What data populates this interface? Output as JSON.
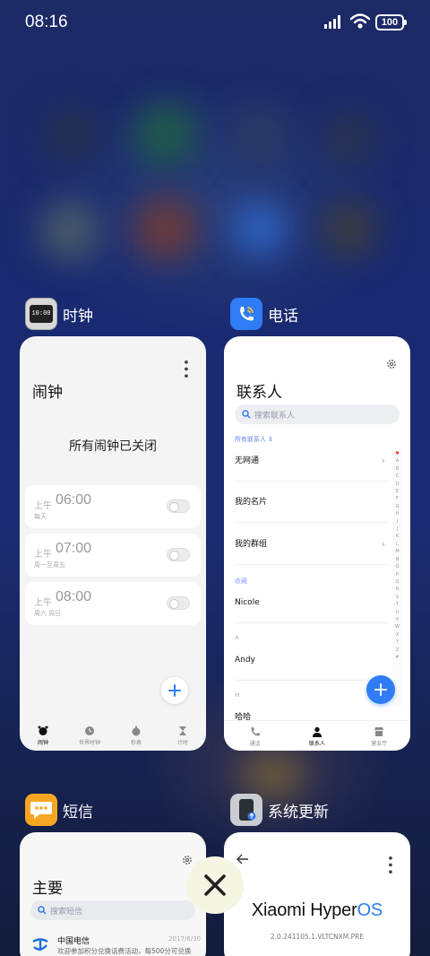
{
  "status_bar": {
    "time": "08:16",
    "battery": "100"
  },
  "apps": [
    {
      "name": "时钟",
      "icon": "clock-app-icon",
      "icon_text": "10:00",
      "card": {
        "title": "闹钟",
        "empty_text": "所有闹钟已关闭",
        "alarms": [
          {
            "ampm": "上午",
            "time": "06:00",
            "repeat": "每天",
            "enabled": false
          },
          {
            "ampm": "上午",
            "time": "07:00",
            "repeat": "周一至周五",
            "enabled": false
          },
          {
            "ampm": "上午",
            "time": "08:00",
            "repeat": "周六 周日",
            "enabled": false
          }
        ],
        "tabs": [
          {
            "label": "闹钟",
            "icon": "alarm-icon",
            "active": true
          },
          {
            "label": "世界时钟",
            "icon": "world-clock-icon",
            "active": false
          },
          {
            "label": "秒表",
            "icon": "stopwatch-icon",
            "active": false
          },
          {
            "label": "计时",
            "icon": "timer-icon",
            "active": false
          }
        ]
      }
    },
    {
      "name": "电话",
      "icon": "phone-app-icon",
      "card": {
        "title": "联系人",
        "search_placeholder": "搜索联系人",
        "filter": "所有联系人 ⇕",
        "rows": [
          "无网通",
          "我的名片",
          "我的群组"
        ],
        "favorites_header": "收藏",
        "favorite": "Nicole",
        "section_a": "A",
        "contact_a": "Andy",
        "section_h": "H",
        "contact_h": "哈哈",
        "alphabet": [
          "♥",
          "A",
          "B",
          "C",
          "D",
          "E",
          "F",
          "G",
          "H",
          "I",
          "J",
          "K",
          "L",
          "M",
          "N",
          "O",
          "P",
          "Q",
          "R",
          "S",
          "T",
          "U",
          "V",
          "W",
          "X",
          "Y",
          "Z",
          "#"
        ],
        "tabs": [
          {
            "label": "通话",
            "icon": "phone-icon",
            "active": false
          },
          {
            "label": "联系人",
            "icon": "contacts-icon",
            "active": true
          },
          {
            "label": "营业厅",
            "icon": "store-icon",
            "active": false
          }
        ]
      }
    },
    {
      "name": "短信",
      "icon": "messages-app-icon",
      "card": {
        "title": "主要",
        "search_placeholder": "搜索短信",
        "message": {
          "sender": "中国电信",
          "date": "2017/6/30",
          "preview": "欢迎参加积分兑换话费活动，每500分可兑换"
        }
      }
    },
    {
      "name": "系统更新",
      "icon": "system-update-app-icon",
      "card": {
        "brand": "Xiaomi HyperOS",
        "brand_main": "Xiaomi Hyper",
        "brand_accent": "OS",
        "version": "2.0.241105.1.VLTCNXM.PRE"
      }
    }
  ],
  "colors": {
    "accent_blue": "#2f7cf6",
    "hyperos_blue": "#2a7ff0"
  }
}
